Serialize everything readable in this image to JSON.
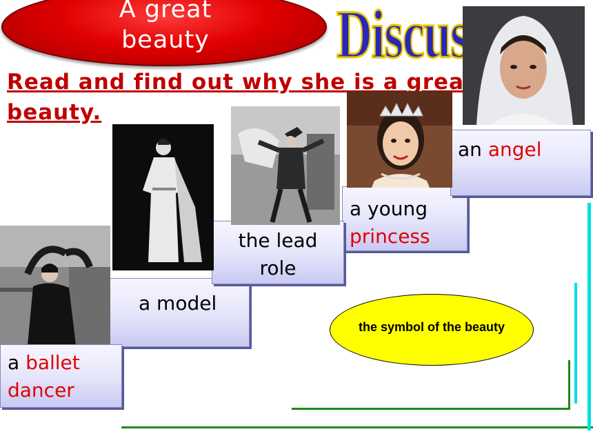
{
  "title": {
    "line1": "A great",
    "line2": "beauty"
  },
  "heading": "Discuss",
  "instruction": {
    "line1": "Read and find out why she is a great",
    "line2": "beauty."
  },
  "steps": [
    {
      "plain": "a ",
      "highlight": "ballet",
      "rest": "dancer"
    },
    {
      "plain": "a model"
    },
    {
      "line1": "the lead",
      "line2": "role"
    },
    {
      "line1": "a young",
      "highlight": "princess"
    },
    {
      "plain": "an ",
      "highlight": "angel"
    }
  ],
  "symbol": "the symbol of the beauty",
  "colors": {
    "accent_red": "#e00000",
    "oval_red": "#e00000",
    "box_fill": "#e6e6fb",
    "ellipse": "#ffff00",
    "line_green": "#1c8a1c",
    "cyan": "#00e0e0"
  },
  "images": [
    {
      "icon": "ballet-dancer-photo"
    },
    {
      "icon": "model-in-gown-photo"
    },
    {
      "icon": "lead-role-scene-photo"
    },
    {
      "icon": "princess-with-tiara-photo"
    },
    {
      "icon": "woman-in-veil-photo"
    }
  ]
}
